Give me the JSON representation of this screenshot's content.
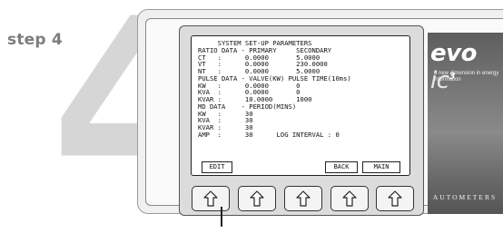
{
  "step": {
    "label": "step 4",
    "number": "4"
  },
  "screen": {
    "lines": [
      "     SYSTEM SET-UP PARAMETERS",
      "RATIO DATA - PRIMARY     SECONDARY",
      "CT   :      0.0000       5.0000",
      "VT   :      0.0000       230.0000",
      "NT   :      0.0000       5.0000",
      "PULSE DATA - VALVE(KW) PULSE TIME(10ms)",
      "KW   :      0.0000       0",
      "KVA  :      0.0000       0",
      "KVAR :      10.0000      1000",
      "MD DATA    - PERIOD(MINS)",
      "KW   :      30",
      "KVA  :      30",
      "KVAR :      30",
      "AMP  :      30      LOG INTERVAL : 0"
    ],
    "softkeys": {
      "edit": "EDIT",
      "back": "BACK",
      "main": "MAIN"
    }
  },
  "buttons": {
    "count": 5,
    "icon": "up-arrow-icon"
  },
  "brand": {
    "logo_main": "evo",
    "logo_ic": "ic",
    "logo_sup": "3",
    "tagline": "a new dimension in energy information",
    "company": "AUTOMETERS"
  }
}
